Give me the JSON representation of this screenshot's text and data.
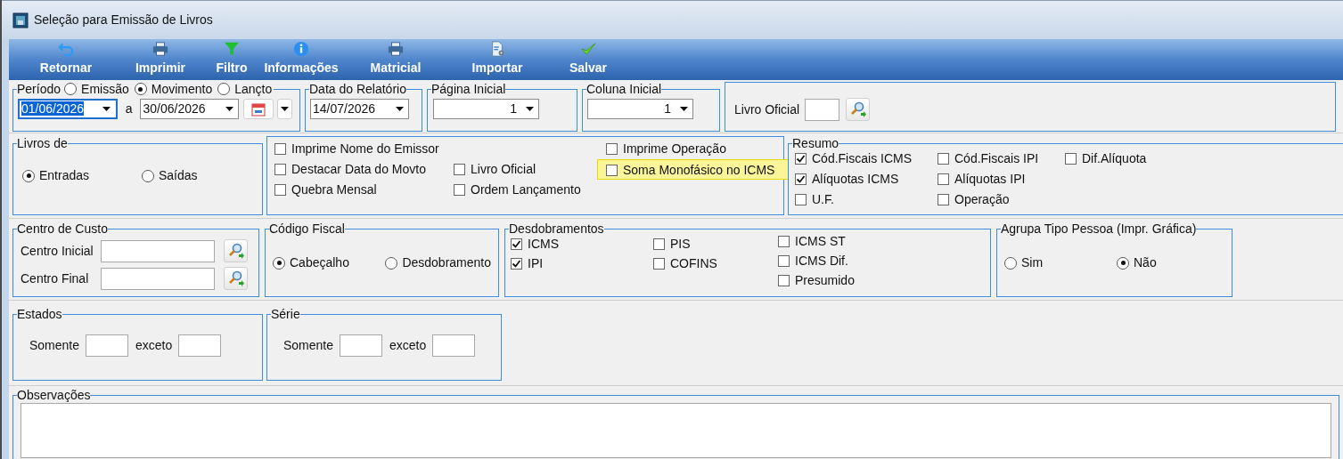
{
  "window": {
    "title": "Seleção para Emissão de Livros"
  },
  "toolbar": [
    {
      "label": "Retornar",
      "kind": "undo"
    },
    {
      "label": "Imprimir",
      "kind": "print"
    },
    {
      "label": "Filtro",
      "kind": "filter"
    },
    {
      "label": "Informações",
      "kind": "info"
    },
    {
      "label": "Matricial",
      "kind": "print"
    },
    {
      "label": "Importar",
      "kind": "import"
    },
    {
      "label": "Salvar",
      "kind": "save"
    }
  ],
  "periodo": {
    "legend": "Período",
    "options": [
      {
        "label": "Emissão",
        "selected": false
      },
      {
        "label": "Movimento",
        "selected": true
      },
      {
        "label": "Lançto",
        "selected": false
      }
    ],
    "start": "01/06/2026",
    "separator": "a",
    "end": "30/06/2026"
  },
  "data_relatorio": {
    "legend": "Data do Relatório",
    "value": "14/07/2026"
  },
  "pagina_inicial": {
    "legend": "Página Inicial",
    "value": "1"
  },
  "coluna_inicial": {
    "legend": "Coluna Inicial",
    "value": "1"
  },
  "livro_oficial": {
    "label": "Livro Oficial"
  },
  "livros_de": {
    "legend": "Livros de",
    "options": [
      {
        "label": "Entradas",
        "selected": true
      },
      {
        "label": "Saídas",
        "selected": false
      }
    ]
  },
  "opcoes": [
    {
      "label": "Imprime Nome do Emissor",
      "checked": false,
      "highlighted": false
    },
    {
      "label": "Imprime Operação",
      "checked": false,
      "highlighted": false
    },
    {
      "label": "Destacar Data do Movto",
      "checked": false,
      "highlighted": false
    },
    {
      "label": "Livro Oficial",
      "checked": false,
      "highlighted": false
    },
    {
      "label": "Soma Monofásico no ICMS",
      "checked": false,
      "highlighted": true
    },
    {
      "label": "Quebra Mensal",
      "checked": false,
      "highlighted": false
    },
    {
      "label": "Ordem Lançamento",
      "checked": false,
      "highlighted": false
    }
  ],
  "resumo": {
    "legend": "Resumo",
    "columns": [
      [
        {
          "label": "Cód.Fiscais ICMS",
          "checked": true
        },
        {
          "label": "Alíquotas ICMS",
          "checked": true
        },
        {
          "label": "U.F.",
          "checked": false
        }
      ],
      [
        {
          "label": "Cód.Fiscais IPI",
          "checked": false
        },
        {
          "label": "Alíquotas IPI",
          "checked": false
        },
        {
          "label": "Operação",
          "checked": false
        }
      ],
      [
        {
          "label": "Dif.Alíquota",
          "checked": false
        }
      ]
    ]
  },
  "centro_de_custo": {
    "legend": "Centro de Custo",
    "fields": [
      {
        "label": "Centro Inicial"
      },
      {
        "label": "Centro Final"
      }
    ]
  },
  "codigo_fiscal": {
    "legend": "Código Fiscal",
    "options": [
      {
        "label": "Cabeçalho",
        "selected": true
      },
      {
        "label": "Desdobramento",
        "selected": false
      }
    ]
  },
  "desdobramentos": {
    "legend": "Desdobramentos",
    "columns": [
      [
        {
          "label": "ICMS",
          "checked": true
        },
        {
          "label": "IPI",
          "checked": true
        }
      ],
      [
        {
          "label": "PIS",
          "checked": false
        },
        {
          "label": "COFINS",
          "checked": false
        }
      ],
      [
        {
          "label": "ICMS ST",
          "checked": false
        },
        {
          "label": "ICMS Dif.",
          "checked": false
        },
        {
          "label": "Presumido",
          "checked": false
        }
      ]
    ]
  },
  "agrupa_tipo_pessoa": {
    "legend": "Agrupa Tipo Pessoa (Impr. Gráfica)",
    "options": [
      {
        "label": "Sim",
        "selected": false
      },
      {
        "label": "Não",
        "selected": true
      }
    ]
  },
  "estados": {
    "legend": "Estados",
    "only_label": "Somente",
    "except_label": "exceto"
  },
  "serie": {
    "legend": "Série",
    "only_label": "Somente",
    "except_label": "exceto"
  },
  "observacoes": {
    "legend": "Observações"
  }
}
